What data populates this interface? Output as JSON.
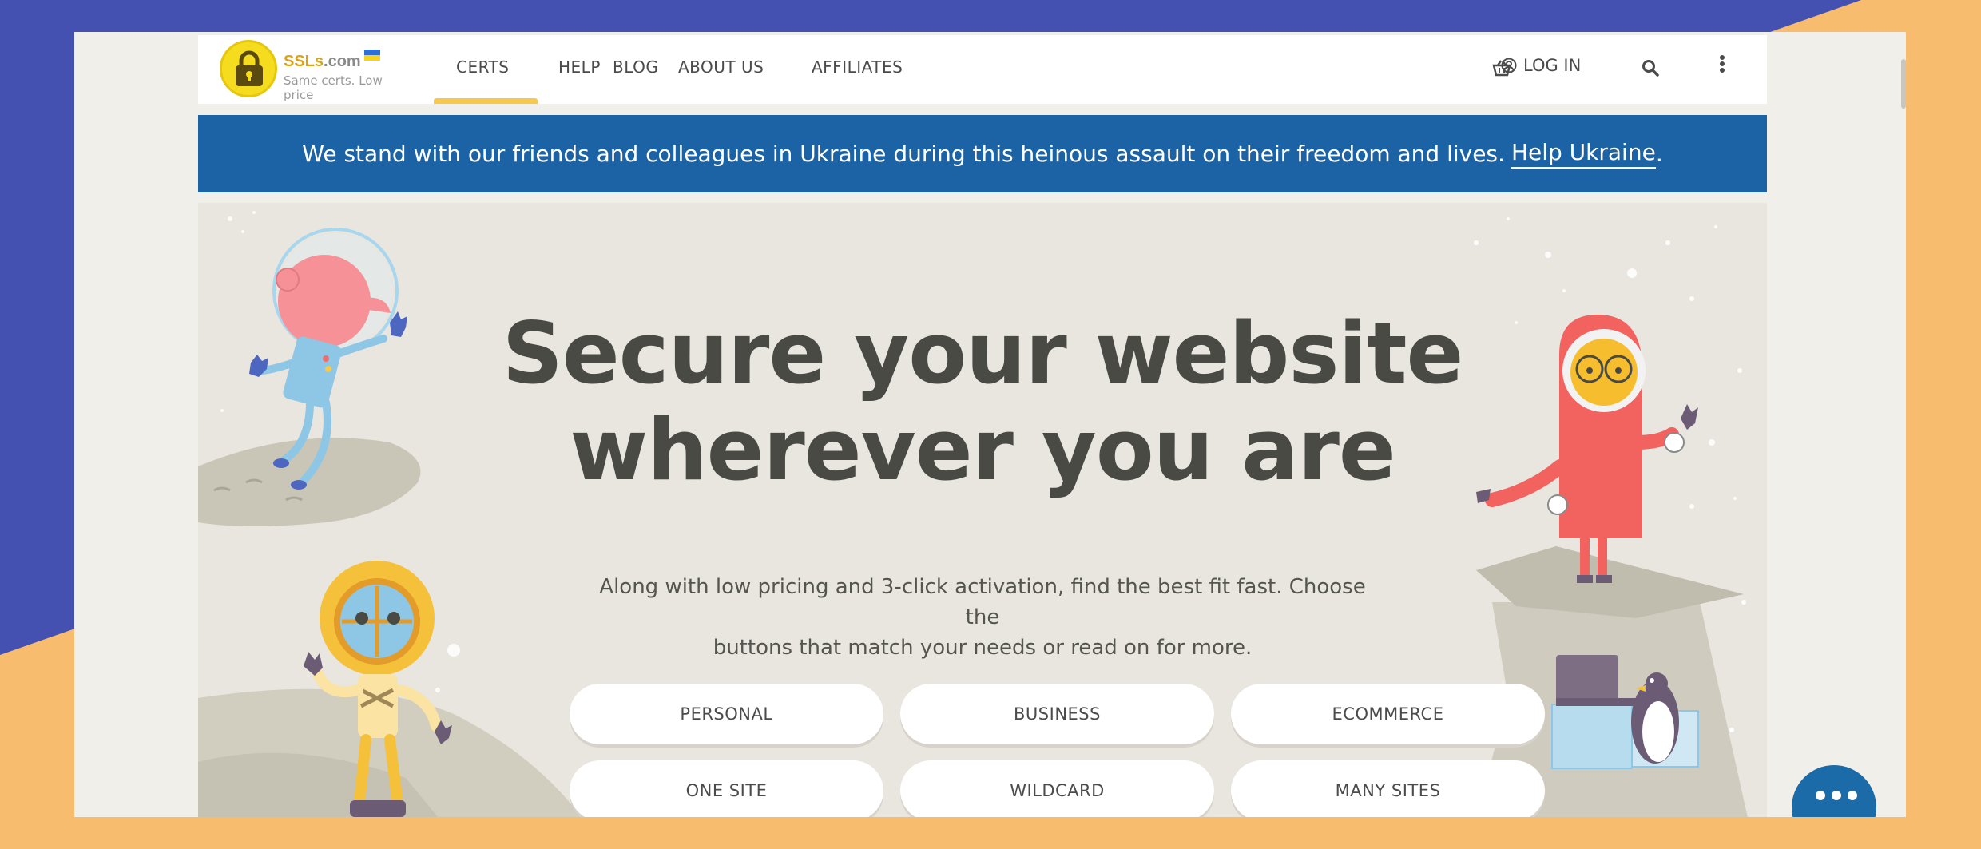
{
  "brand": {
    "name": "SSLs",
    "domain_suffix": ".com",
    "tagline": "Same certs. Low price"
  },
  "nav": {
    "items": [
      {
        "label": "CERTS",
        "active": true
      },
      {
        "label": "HELP",
        "active": false
      },
      {
        "label": "BLOG",
        "active": false
      },
      {
        "label": "ABOUT US",
        "active": false
      },
      {
        "label": "AFFILIATES",
        "active": false
      }
    ],
    "cart_icon": "basket-icon",
    "login_label": "LOG IN",
    "login_icon": "user-circle-icon",
    "search_icon": "search-icon",
    "more_icon": "vertical-dots-icon"
  },
  "banner": {
    "text": "We stand with our friends and colleagues in Ukraine during this heinous assault on their freedom and lives.",
    "link_label": "Help Ukraine",
    "link_suffix": "."
  },
  "hero": {
    "title_line1": "Secure your website",
    "title_line2": "wherever you are",
    "subtitle_line1": "Along with low pricing and 3-click activation, find the best fit fast. Choose the",
    "subtitle_line2": "buttons that match your needs or read on for more."
  },
  "categories": [
    {
      "label": "PERSONAL"
    },
    {
      "label": "BUSINESS"
    },
    {
      "label": "ECOMMERCE"
    },
    {
      "label": "ONE SITE"
    },
    {
      "label": "WILDCARD"
    },
    {
      "label": "MANY SITES"
    }
  ],
  "chat": {
    "icon": "chat-dots-icon"
  },
  "colors": {
    "accent": "#F6C84B",
    "banner": "#1C63A6",
    "backdrop_blue": "#4451B1",
    "backdrop_orange": "#F7BC6D",
    "chat": "#1A6BA8"
  }
}
